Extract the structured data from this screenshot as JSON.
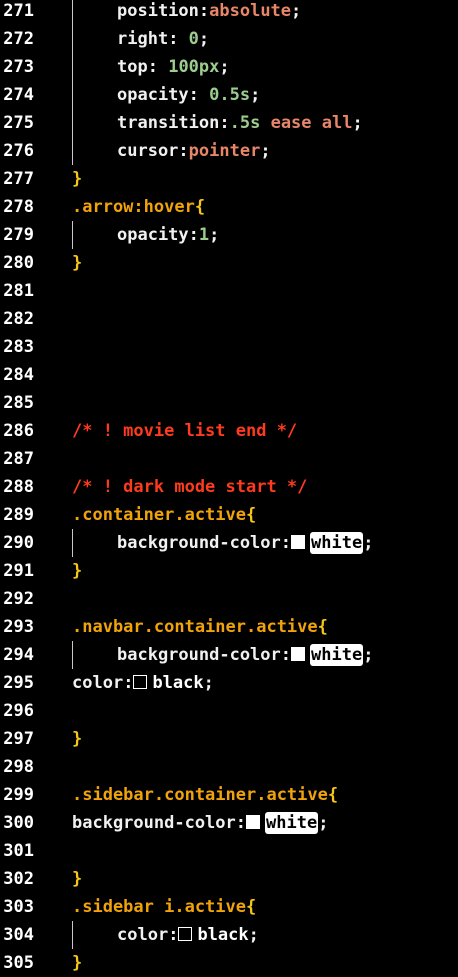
{
  "editor": {
    "lines": [
      {
        "n": "271",
        "indent": true,
        "tokens": [
          [
            "position",
            "prop"
          ],
          [
            ":",
            "punct"
          ],
          [
            "absolute",
            "kw"
          ],
          [
            ";",
            "punct"
          ]
        ]
      },
      {
        "n": "272",
        "indent": true,
        "tokens": [
          [
            "right",
            "prop"
          ],
          [
            ": ",
            "punct"
          ],
          [
            "0",
            "num"
          ],
          [
            ";",
            "punct"
          ]
        ]
      },
      {
        "n": "273",
        "indent": true,
        "tokens": [
          [
            "top",
            "prop"
          ],
          [
            ": ",
            "punct"
          ],
          [
            "100px",
            "num"
          ],
          [
            ";",
            "punct"
          ]
        ]
      },
      {
        "n": "274",
        "indent": true,
        "tokens": [
          [
            "opacity",
            "prop"
          ],
          [
            ": ",
            "punct"
          ],
          [
            "0.5s",
            "num"
          ],
          [
            ";",
            "punct"
          ]
        ]
      },
      {
        "n": "275",
        "indent": true,
        "tokens": [
          [
            "transition",
            "prop"
          ],
          [
            ":",
            "punct"
          ],
          [
            ".5s",
            "num"
          ],
          [
            " ",
            "punct"
          ],
          [
            "ease",
            "kw"
          ],
          [
            " ",
            "punct"
          ],
          [
            "all",
            "kw"
          ],
          [
            ";",
            "punct"
          ]
        ]
      },
      {
        "n": "276",
        "indent": true,
        "tokens": [
          [
            "cursor",
            "prop"
          ],
          [
            ":",
            "punct"
          ],
          [
            "pointer",
            "kw"
          ],
          [
            ";",
            "punct"
          ]
        ]
      },
      {
        "n": "277",
        "indent": false,
        "tokens": [
          [
            "}",
            "brace"
          ]
        ]
      },
      {
        "n": "278",
        "indent": false,
        "tokens": [
          [
            ".arrow:hover",
            "sel"
          ],
          [
            "{",
            "brace"
          ]
        ]
      },
      {
        "n": "279",
        "indent": true,
        "tokens": [
          [
            "opacity",
            "prop"
          ],
          [
            ":",
            "punct"
          ],
          [
            "1",
            "num"
          ],
          [
            ";",
            "punct"
          ]
        ]
      },
      {
        "n": "280",
        "indent": false,
        "tokens": [
          [
            "}",
            "brace"
          ]
        ]
      },
      {
        "n": "281",
        "indent": false,
        "tokens": []
      },
      {
        "n": "282",
        "indent": false,
        "tokens": []
      },
      {
        "n": "283",
        "indent": false,
        "tokens": []
      },
      {
        "n": "284",
        "indent": false,
        "tokens": []
      },
      {
        "n": "285",
        "indent": false,
        "tokens": []
      },
      {
        "n": "286",
        "indent": false,
        "tokens": [
          [
            "/* ! movie list end */",
            "comment"
          ]
        ]
      },
      {
        "n": "287",
        "indent": false,
        "tokens": []
      },
      {
        "n": "288",
        "indent": false,
        "tokens": [
          [
            "/* ! dark mode start */",
            "comment"
          ]
        ]
      },
      {
        "n": "289",
        "indent": false,
        "tokens": [
          [
            ".container.active",
            "sel"
          ],
          [
            "{",
            "brace"
          ]
        ]
      },
      {
        "n": "290",
        "indent": true,
        "tokens": [
          [
            "background-color",
            "prop"
          ],
          [
            ":",
            "punct"
          ],
          [
            "",
            "swatch-white"
          ],
          [
            "white",
            "hl-white"
          ],
          [
            ";",
            "punct"
          ]
        ]
      },
      {
        "n": "291",
        "indent": false,
        "tokens": [
          [
            "}",
            "brace"
          ]
        ]
      },
      {
        "n": "292",
        "indent": false,
        "tokens": []
      },
      {
        "n": "293",
        "indent": false,
        "tokens": [
          [
            ".navbar.container.active",
            "sel"
          ],
          [
            "{",
            "brace"
          ]
        ]
      },
      {
        "n": "294",
        "indent": true,
        "tokens": [
          [
            "background-color",
            "prop"
          ],
          [
            ":",
            "punct"
          ],
          [
            "",
            "swatch-white"
          ],
          [
            "white",
            "hl-white"
          ],
          [
            ";",
            "punct"
          ]
        ]
      },
      {
        "n": "295",
        "indent": false,
        "tokens": [
          [
            "color",
            "prop"
          ],
          [
            ":",
            "punct"
          ],
          [
            "",
            "swatch-black"
          ],
          [
            "black",
            "plain"
          ],
          [
            ";",
            "punct"
          ]
        ]
      },
      {
        "n": "296",
        "indent": false,
        "tokens": []
      },
      {
        "n": "297",
        "indent": false,
        "tokens": [
          [
            "}",
            "brace"
          ]
        ]
      },
      {
        "n": "298",
        "indent": false,
        "tokens": []
      },
      {
        "n": "299",
        "indent": false,
        "tokens": [
          [
            ".sidebar.container.active",
            "sel"
          ],
          [
            "{",
            "brace"
          ]
        ]
      },
      {
        "n": "300",
        "indent": false,
        "tokens": [
          [
            "background-color",
            "prop"
          ],
          [
            ":",
            "punct"
          ],
          [
            "",
            "swatch-white"
          ],
          [
            "white",
            "hl-white"
          ],
          [
            ";",
            "punct"
          ]
        ]
      },
      {
        "n": "301",
        "indent": false,
        "tokens": []
      },
      {
        "n": "302",
        "indent": false,
        "tokens": [
          [
            "}",
            "brace"
          ]
        ]
      },
      {
        "n": "303",
        "indent": false,
        "tokens": [
          [
            ".sidebar i.active",
            "sel"
          ],
          [
            "{",
            "brace"
          ]
        ]
      },
      {
        "n": "304",
        "indent": true,
        "tokens": [
          [
            "color",
            "prop"
          ],
          [
            ":",
            "punct"
          ],
          [
            "",
            "swatch-black"
          ],
          [
            "black",
            "plain"
          ],
          [
            ";",
            "punct"
          ]
        ]
      },
      {
        "n": "305",
        "indent": false,
        "tokens": [
          [
            "}",
            "brace"
          ]
        ]
      }
    ]
  },
  "colors": {
    "background": "#000000",
    "selector": "#f0a30a",
    "brace": "#f5c518",
    "property": "#f1f1f1",
    "keyword": "#e8866a",
    "number": "#9ccc8e",
    "comment": "#ff3a1e"
  }
}
